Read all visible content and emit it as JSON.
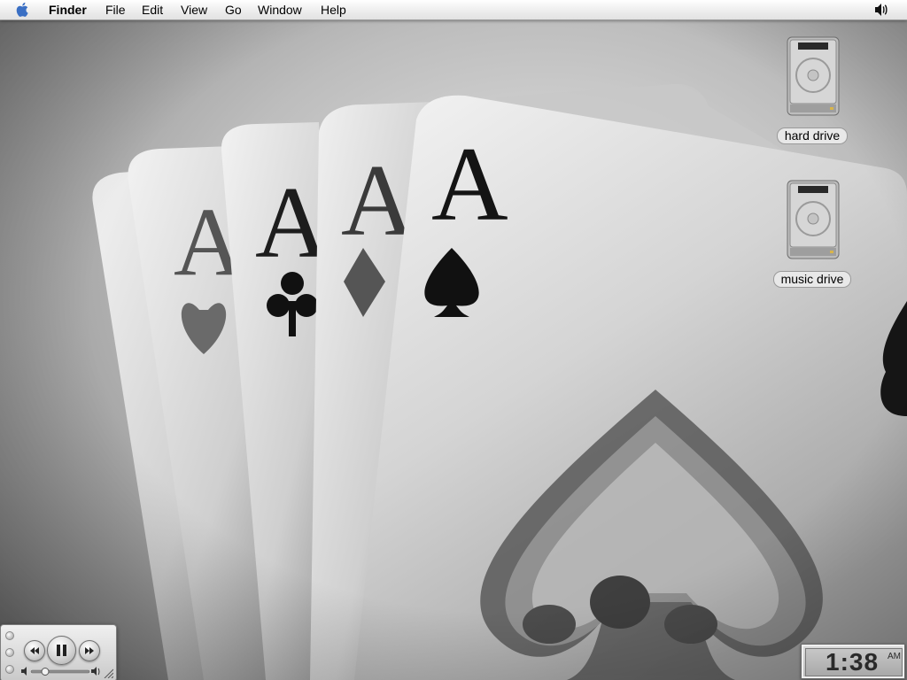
{
  "menubar": {
    "apple_icon": "apple-logo-icon",
    "items": [
      {
        "label": "Finder"
      },
      {
        "label": "File"
      },
      {
        "label": "Edit"
      },
      {
        "label": "View"
      },
      {
        "label": "Go"
      },
      {
        "label": "Window"
      },
      {
        "label": "Help"
      }
    ],
    "volume_icon": "speaker-volume-icon"
  },
  "desktop": {
    "wallpaper": "black-and-white photo of four aces fanned (hearts, clubs, diamonds, spades)",
    "icons": [
      {
        "label": "hard drive",
        "icon": "hard-drive-icon"
      },
      {
        "label": "music drive",
        "icon": "hard-drive-icon"
      }
    ]
  },
  "media_controller": {
    "buttons": [
      "rewind-icon",
      "pause-icon",
      "fast-forward-icon"
    ],
    "volume_icons": [
      "volume-low-icon",
      "volume-high-icon"
    ]
  },
  "clock": {
    "time": "1:38",
    "ampm": "AM"
  }
}
